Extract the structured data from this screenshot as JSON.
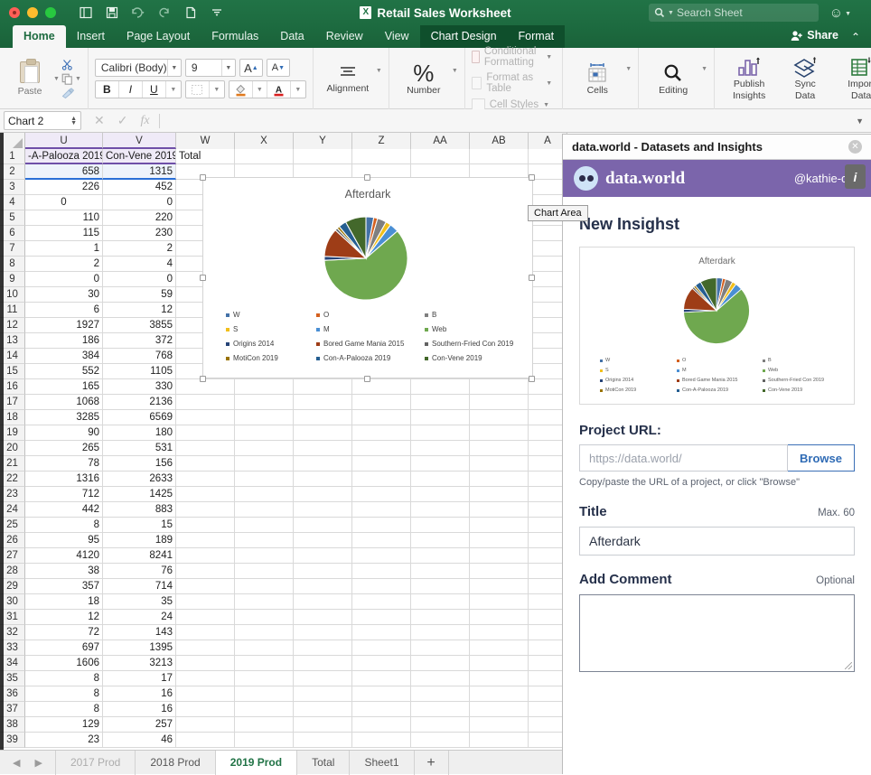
{
  "window": {
    "document_title": "Retail Sales Worksheet",
    "traffic_lights": [
      "close",
      "minimize",
      "zoom"
    ],
    "quick_access": [
      "sidebar-toggle",
      "save",
      "undo",
      "redo",
      "new-document",
      "customize-toolbar"
    ],
    "search_placeholder": "Search Sheet"
  },
  "ribbon": {
    "tabs": [
      {
        "label": "Home",
        "active": true
      },
      {
        "label": "Insert",
        "active": false
      },
      {
        "label": "Page Layout",
        "active": false
      },
      {
        "label": "Formulas",
        "active": false
      },
      {
        "label": "Data",
        "active": false
      },
      {
        "label": "Review",
        "active": false
      },
      {
        "label": "View",
        "active": false
      },
      {
        "label": "Chart Design",
        "active": false,
        "contextual": true
      },
      {
        "label": "Format",
        "active": false,
        "contextual": true
      }
    ],
    "share_label": "Share",
    "clipboard": {
      "paste_label": "Paste",
      "cut": "scissors-icon",
      "copy": "copy-icon",
      "format_painter": "paintbrush-icon"
    },
    "font": {
      "family_value": "Calibri (Body)",
      "size_value": "9",
      "grow_font": "A▲",
      "shrink_font": "A▼",
      "bold": "B",
      "italic": "I",
      "underline": "U"
    },
    "alignment_label": "Alignment",
    "number_label": "Number",
    "styles": [
      "Conditional Formatting",
      "Format as Table",
      "Cell Styles"
    ],
    "cells_label": "Cells",
    "editing_label": "Editing",
    "addins": [
      {
        "label_line1": "Publish",
        "label_line2": "Insights"
      },
      {
        "label_line1": "Sync",
        "label_line2": "Data"
      },
      {
        "label_line1": "Import",
        "label_line2": "Data"
      }
    ]
  },
  "formula_bar": {
    "name_box_value": "Chart 2",
    "cancel_icon": "close-icon",
    "confirm_icon": "check-icon",
    "function_icon": "fx-icon",
    "formula_value": ""
  },
  "grid": {
    "column_headers": [
      "U",
      "V",
      "W",
      "X",
      "Y",
      "Z",
      "AA",
      "AB",
      "A"
    ],
    "row_numbers": [
      1,
      2,
      3,
      4,
      5,
      6,
      7,
      8,
      9,
      10,
      11,
      12,
      13,
      14,
      15,
      16,
      17,
      18,
      19,
      20,
      21,
      22,
      23,
      24,
      25,
      26,
      27,
      28,
      29,
      30,
      31,
      32,
      33,
      34,
      35,
      36,
      37,
      38,
      39
    ],
    "header_row": {
      "U": "-A-Palooza 2019",
      "V": "Con-Vene 2019",
      "W": "Total"
    },
    "rows": [
      {
        "n": 2,
        "U": "658",
        "V": "1315"
      },
      {
        "n": 3,
        "U": "226",
        "V": "452"
      },
      {
        "n": 4,
        "U": "0",
        "V": "0",
        "u_align": "center"
      },
      {
        "n": 5,
        "U": "110",
        "V": "220"
      },
      {
        "n": 6,
        "U": "115",
        "V": "230"
      },
      {
        "n": 7,
        "U": "1",
        "V": "2"
      },
      {
        "n": 8,
        "U": "2",
        "V": "4"
      },
      {
        "n": 9,
        "U": "0",
        "V": "0"
      },
      {
        "n": 10,
        "U": "30",
        "V": "59"
      },
      {
        "n": 11,
        "U": "6",
        "V": "12"
      },
      {
        "n": 12,
        "U": "1927",
        "V": "3855"
      },
      {
        "n": 13,
        "U": "186",
        "V": "372"
      },
      {
        "n": 14,
        "U": "384",
        "V": "768"
      },
      {
        "n": 15,
        "U": "552",
        "V": "1105"
      },
      {
        "n": 16,
        "U": "165",
        "V": "330"
      },
      {
        "n": 17,
        "U": "1068",
        "V": "2136"
      },
      {
        "n": 18,
        "U": "3285",
        "V": "6569"
      },
      {
        "n": 19,
        "U": "90",
        "V": "180"
      },
      {
        "n": 20,
        "U": "265",
        "V": "531"
      },
      {
        "n": 21,
        "U": "78",
        "V": "156"
      },
      {
        "n": 22,
        "U": "1316",
        "V": "2633"
      },
      {
        "n": 23,
        "U": "712",
        "V": "1425"
      },
      {
        "n": 24,
        "U": "442",
        "V": "883"
      },
      {
        "n": 25,
        "U": "8",
        "V": "15"
      },
      {
        "n": 26,
        "U": "95",
        "V": "189"
      },
      {
        "n": 27,
        "U": "4120",
        "V": "8241"
      },
      {
        "n": 28,
        "U": "38",
        "V": "76"
      },
      {
        "n": 29,
        "U": "357",
        "V": "714"
      },
      {
        "n": 30,
        "U": "18",
        "V": "35"
      },
      {
        "n": 31,
        "U": "12",
        "V": "24"
      },
      {
        "n": 32,
        "U": "72",
        "V": "143"
      },
      {
        "n": 33,
        "U": "697",
        "V": "1395"
      },
      {
        "n": 34,
        "U": "1606",
        "V": "3213"
      },
      {
        "n": 35,
        "U": "8",
        "V": "17"
      },
      {
        "n": 36,
        "U": "8",
        "V": "16"
      },
      {
        "n": 37,
        "U": "8",
        "V": "16"
      },
      {
        "n": 38,
        "U": "129",
        "V": "257"
      },
      {
        "n": 39,
        "U": "23",
        "V": "46"
      }
    ]
  },
  "chart_tooltip": "Chart Area",
  "chart_data": {
    "type": "pie",
    "title": "Afterdark",
    "legend_position": "bottom",
    "categories": [
      "W",
      "O",
      "B",
      "S",
      "M",
      "Web",
      "Origins 2014",
      "Bored Game Mania 2015",
      "Southern-Fried Con 2019",
      "MotiCon 2019",
      "Con-A-Palooza 2019",
      "Con-Vene 2019"
    ],
    "values": [
      3.0,
      1.5,
      3.5,
      2.0,
      3.5,
      60.0,
      1.5,
      11.0,
      1.0,
      1.0,
      3.0,
      8.0
    ],
    "colors": [
      "#4472a8",
      "#d4601f",
      "#7f7f7f",
      "#f1bf1b",
      "#4a8fd4",
      "#6aa churches",
      "#264478",
      "#9e3d17",
      "#636363",
      "#997300",
      "#255e91",
      "#43682b"
    ],
    "slice_colors": [
      "#4472a8",
      "#d4601f",
      "#7f7f7f",
      "#f1bf1b",
      "#4a8fd4",
      "#6fa84f",
      "#264478",
      "#9e3d17",
      "#636363",
      "#997300",
      "#255e91",
      "#43682b"
    ]
  },
  "sheet_tabs": {
    "nav_prev": "prev-sheet-arrow",
    "nav_next": "next-sheet-arrow",
    "tabs": [
      {
        "label": "2017 Prod",
        "active": false,
        "dim": true
      },
      {
        "label": "2018 Prod",
        "active": false,
        "dim": false
      },
      {
        "label": "2019 Prod",
        "active": true,
        "dim": false
      },
      {
        "label": "Total",
        "active": false,
        "dim": false
      },
      {
        "label": "Sheet1",
        "active": false,
        "dim": false
      }
    ],
    "add_label": "+"
  },
  "panel": {
    "window_title": "data.world - Datasets and Insights",
    "brand": "data.world",
    "user": "@kathie-coo",
    "info_button": "i",
    "heading": "New Insighst",
    "project_url": {
      "label": "Project URL:",
      "placeholder": "https://data.world/",
      "value": "",
      "browse_label": "Browse",
      "hint": "Copy/paste the URL of a project, or click \"Browse\""
    },
    "title_field": {
      "label": "Title",
      "meta": "Max. 60",
      "value": "Afterdark"
    },
    "comment_field": {
      "label": "Add Comment",
      "meta": "Optional",
      "value": ""
    }
  }
}
